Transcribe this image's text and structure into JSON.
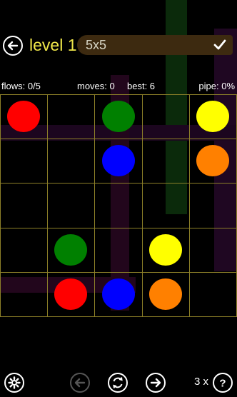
{
  "header": {
    "level_label": "level 1",
    "size_label": "5x5"
  },
  "stats": {
    "flows": "flows: 0/5",
    "moves": "moves: 0",
    "best": "best: 6",
    "pipe": "pipe: 0%"
  },
  "board": {
    "rows": 5,
    "cols": 5,
    "dots": [
      {
        "row": 0,
        "col": 0,
        "color": "red",
        "hex": "#ff0000"
      },
      {
        "row": 0,
        "col": 2,
        "color": "green",
        "hex": "#008000"
      },
      {
        "row": 0,
        "col": 4,
        "color": "yellow",
        "hex": "#ffff00"
      },
      {
        "row": 1,
        "col": 2,
        "color": "blue",
        "hex": "#0000ff"
      },
      {
        "row": 1,
        "col": 4,
        "color": "orange",
        "hex": "#ff8000"
      },
      {
        "row": 3,
        "col": 1,
        "color": "green",
        "hex": "#008000"
      },
      {
        "row": 3,
        "col": 3,
        "color": "yellow",
        "hex": "#ffff00"
      },
      {
        "row": 4,
        "col": 1,
        "color": "red",
        "hex": "#ff0000"
      },
      {
        "row": 4,
        "col": 2,
        "color": "blue",
        "hex": "#0000ff"
      },
      {
        "row": 4,
        "col": 3,
        "color": "orange",
        "hex": "#ff8000"
      }
    ]
  },
  "footer": {
    "hints_label": "3 x",
    "icons": [
      "settings-icon",
      "undo-icon",
      "restart-icon",
      "next-icon",
      "help-icon"
    ]
  },
  "colors": {
    "title_yellow": "#f1e84a",
    "grid_line": "#8c7f28",
    "badge_bg": "#3d2a10"
  }
}
